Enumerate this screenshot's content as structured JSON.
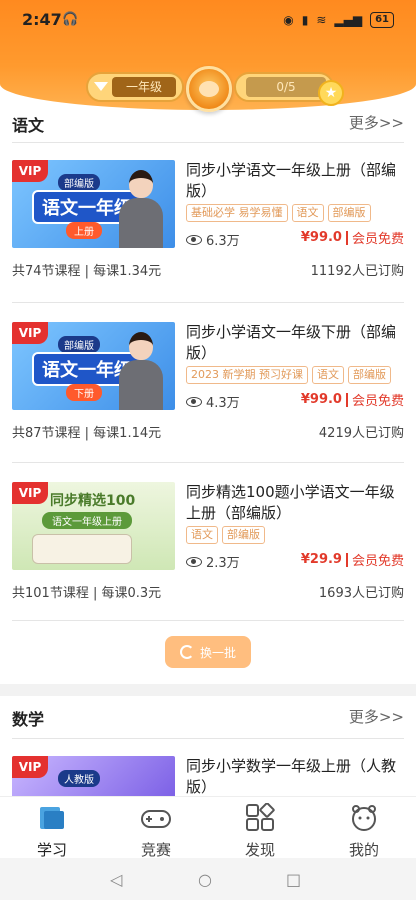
{
  "status": {
    "time": "2:47",
    "headphone_icon": "headphone-icon",
    "battery": "61"
  },
  "header": {
    "level_label": "一年级",
    "progress_text": "0/5"
  },
  "sections": [
    {
      "title": "语文",
      "more": "更多>>",
      "courses": [
        {
          "thumb_pub": "部编版",
          "thumb_subject": "语文一年级",
          "thumb_term": "上册",
          "title": "同步小学语文一年级上册（部编版）",
          "tags": [
            "基础必学 易学易懂",
            "语文",
            "部编版"
          ],
          "views": "6.3万",
          "price": "¥99.0",
          "member": "会员免费",
          "meta": "共74节课程 | 每课1.34元",
          "subscribers": "11192人已订购"
        },
        {
          "thumb_pub": "部编版",
          "thumb_subject": "语文一年级",
          "thumb_term": "下册",
          "title": "同步小学语文一年级下册（部编版）",
          "tags": [
            "2023 新学期  预习好课",
            "语文",
            "部编版"
          ],
          "views": "4.3万",
          "price": "¥99.0",
          "member": "会员免费",
          "meta": "共87节课程 | 每课1.14元",
          "subscribers": "4219人已订购"
        },
        {
          "thumb_title": "同步精选100",
          "thumb_sub": "语文一年级上册",
          "title": "同步精选100题小学语文一年级上册（部编版）",
          "tags": [
            "语文",
            "部编版"
          ],
          "views": "2.3万",
          "price": "¥29.9",
          "member": "会员免费",
          "meta": "共101节课程 | 每课0.3元",
          "subscribers": "1693人已订购"
        }
      ],
      "refresh_label": "换一批"
    },
    {
      "title": "数学",
      "more": "更多>>",
      "courses": [
        {
          "thumb_pub": "人教版",
          "title": "同步小学数学一年级上册（人教版）"
        }
      ]
    }
  ],
  "tabs": [
    {
      "label": "学习",
      "icon": "book-icon"
    },
    {
      "label": "竞赛",
      "icon": "gamepad-icon"
    },
    {
      "label": "发现",
      "icon": "grid-icon"
    },
    {
      "label": "我的",
      "icon": "mascot-icon"
    }
  ]
}
